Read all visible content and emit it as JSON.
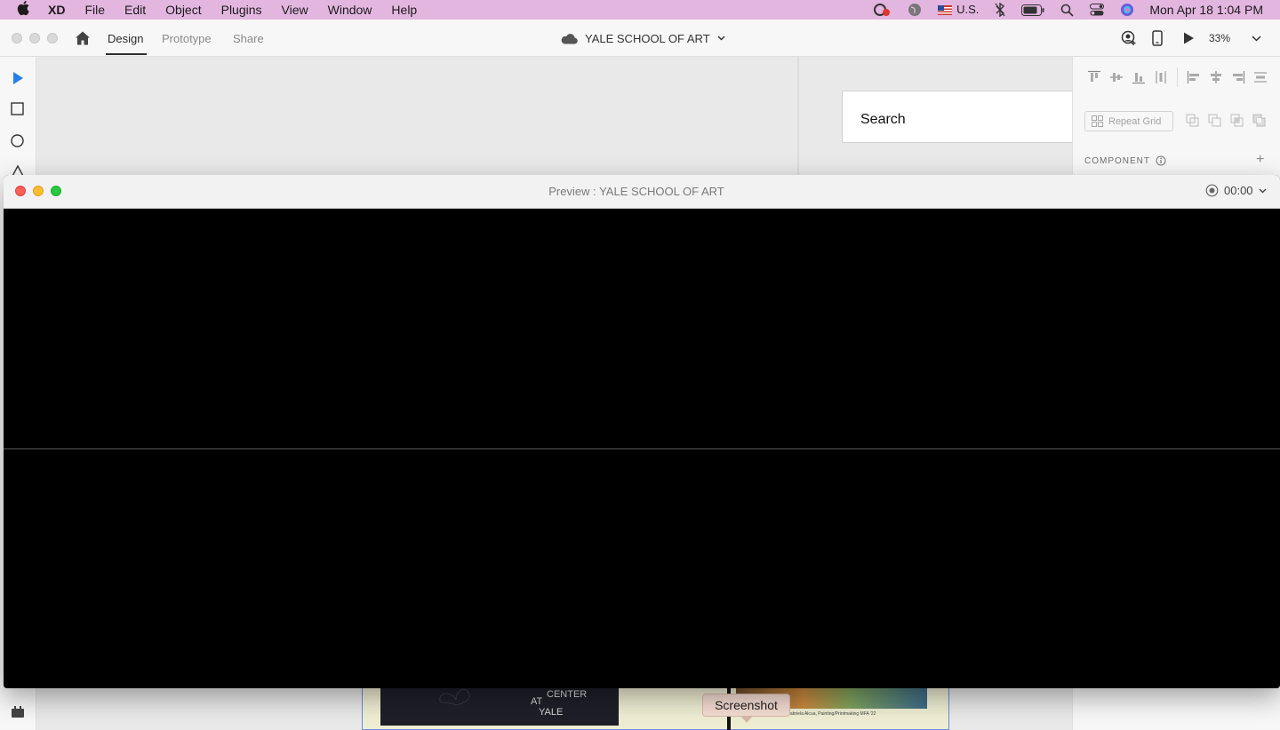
{
  "menubar": {
    "app_name": "XD",
    "items": [
      "File",
      "Edit",
      "Object",
      "Plugins",
      "View",
      "Window",
      "Help"
    ],
    "input_source": "U.S.",
    "clock": "Mon Apr 18  1:04 PM"
  },
  "toolbar": {
    "tabs": [
      "Design",
      "Prototype",
      "Share"
    ],
    "active_tab": "Design",
    "document_title": "YALE SCHOOL OF ART",
    "zoom": "33%"
  },
  "canvas": {
    "search_text": "Search",
    "artboard_texts": {
      "at": "AT",
      "center": "CENTER",
      "yale": "YALE",
      "caption": "...ated by Gabriela Alcua, Painting/Printmaking MFA '22"
    }
  },
  "right_panel": {
    "repeat_grid_label": "Repeat Grid",
    "component_label": "COMPONENT"
  },
  "preview": {
    "title": "Preview : YALE SCHOOL OF ART",
    "timer": "00:00"
  },
  "tooltip": {
    "text": "Screenshot"
  },
  "colors": {
    "menubar": "#e3b6e0",
    "accent_blue": "#2680eb",
    "close": "#fe5f57",
    "minimize": "#febc2e",
    "zoom": "#28c840"
  }
}
